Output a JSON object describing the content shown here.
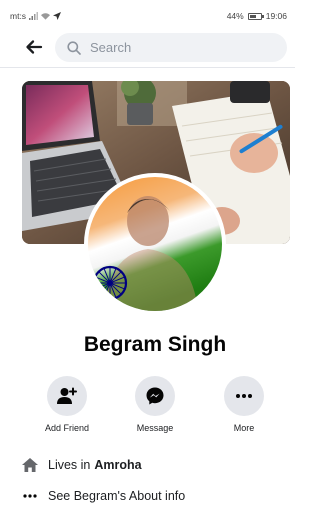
{
  "status_bar": {
    "carrier": "mt:s",
    "battery": "44%",
    "time": "19:06"
  },
  "header": {
    "search_placeholder": "Search"
  },
  "profile": {
    "name": "Begram Singh"
  },
  "actions": [
    {
      "label": "Add Friend",
      "icon": "add-friend-icon"
    },
    {
      "label": "Message",
      "icon": "messenger-icon"
    },
    {
      "label": "More",
      "icon": "more-icon"
    }
  ],
  "intro": {
    "lives_prefix": "Lives in",
    "lives_city": "Amroha",
    "about_text": "See Begram's About info"
  },
  "colors": {
    "accent": "#1b74e4",
    "button_bg": "#e4e6eb",
    "saffron": "#ff9933",
    "green": "#138808",
    "chakra": "#000080"
  }
}
